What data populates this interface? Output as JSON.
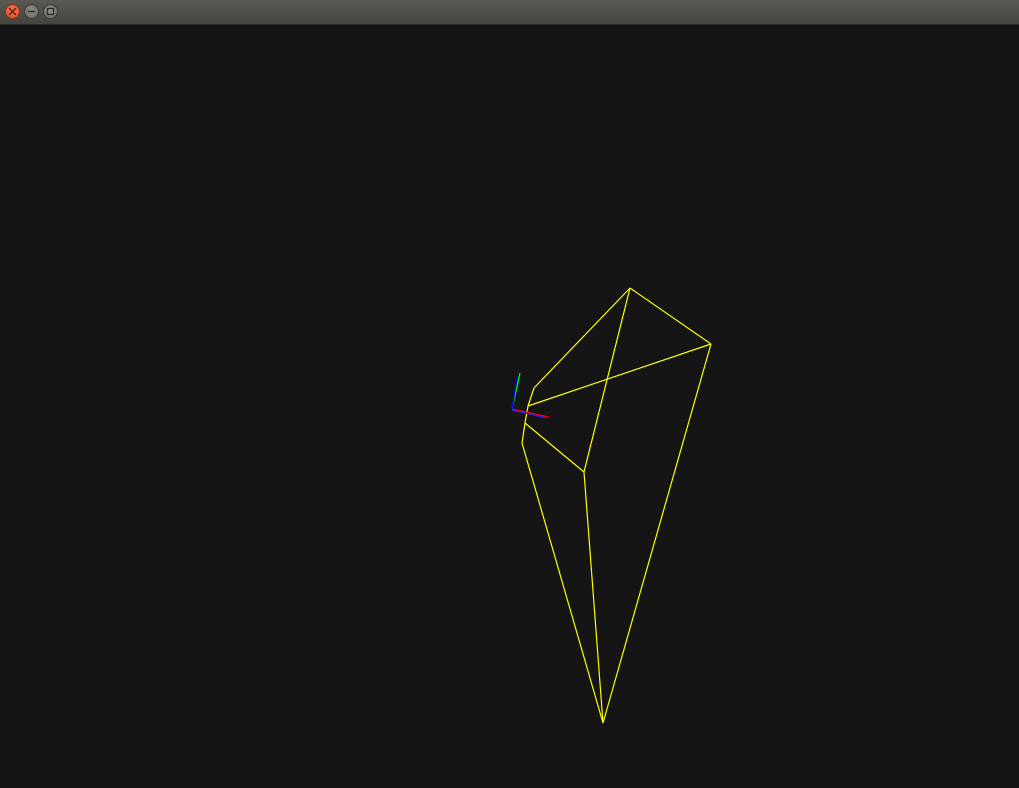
{
  "window": {
    "title": "",
    "buttons": {
      "close": "close-icon",
      "minimize": "minimize-icon",
      "maximize": "maximize-icon"
    }
  },
  "scene": {
    "background_color": "#151515",
    "wireframe_color": "#ffff00",
    "axes": {
      "x_color": "#ff0000",
      "y_color": "#00ff00",
      "z_color": "#0000ff"
    }
  }
}
